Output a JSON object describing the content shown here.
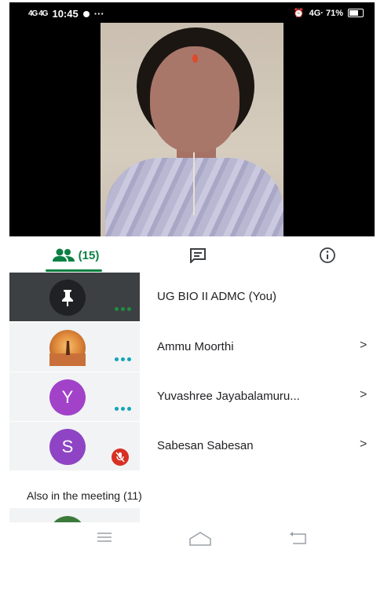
{
  "status_bar": {
    "signal": "4G 4G",
    "time": "10:45",
    "extras": "···",
    "right_text": "4G· 71%"
  },
  "tabs": {
    "people_count": "(15)",
    "people_icon": "people-icon",
    "chat_icon": "chat-icon",
    "info_icon": "info-icon"
  },
  "participants": [
    {
      "name": "UG BIO II ADMC (You)",
      "avatar": "pin-icon",
      "avatar_color": "#202124",
      "status": "speaking-dots",
      "chevron": ""
    },
    {
      "name": "Ammu Moorthi",
      "avatar": "photo",
      "avatar_color": "#d9822b",
      "status": "speaking-dots",
      "chevron": ">"
    },
    {
      "name": "Yuvashree Jayabalamuru...",
      "avatar": "Y",
      "avatar_color": "#a142c9",
      "status": "speaking-dots",
      "chevron": ">"
    },
    {
      "name": "Sabesan Sabesan",
      "avatar": "S",
      "avatar_color": "#8e44c4",
      "status": "muted",
      "chevron": ">"
    }
  ],
  "also_in_meeting": "Also in the meeting (11)",
  "nav": {
    "menu": "menu-icon",
    "home": "home-icon",
    "back": "back-icon"
  },
  "colors": {
    "accent": "#0b8043",
    "mute": "#d93025"
  }
}
